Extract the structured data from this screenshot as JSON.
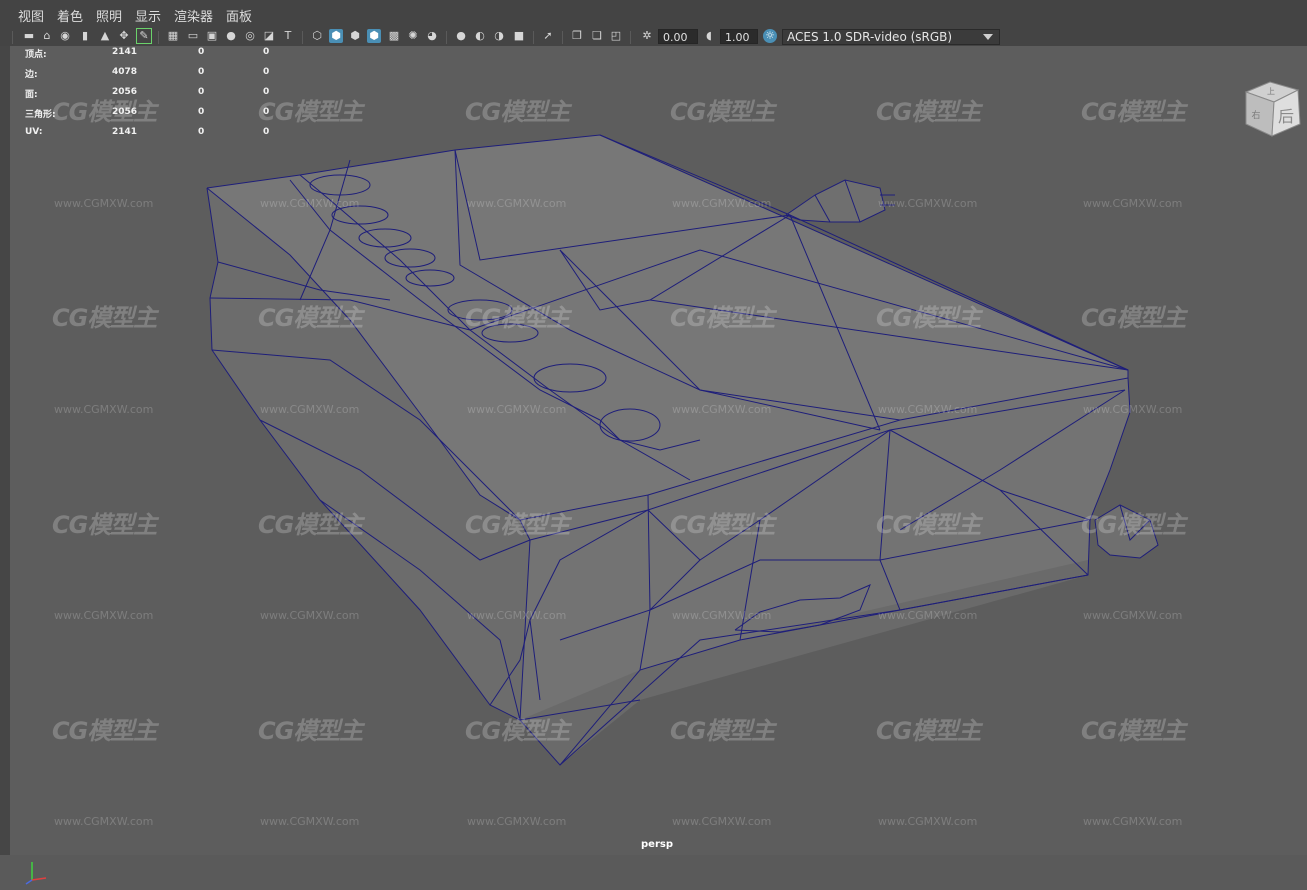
{
  "menu": {
    "items": [
      "视图",
      "着色",
      "照明",
      "显示",
      "渲染器",
      "面板"
    ]
  },
  "toolbar": {
    "exposure_value": "0.00",
    "gamma_value": "1.00",
    "color_space": "ACES 1.0 SDR-video (sRGB)",
    "icons": [
      "camera-icon",
      "lock-camera-icon",
      "camera-attributes-icon",
      "bookmark-icon",
      "image-plane-icon",
      "2d-pan-icon",
      "grease-pencil-icon",
      "grid-icon",
      "film-gate-icon",
      "resolution-gate-icon",
      "gate-mask-icon",
      "field-chart-icon",
      "safe-action-icon",
      "safe-title-icon",
      "wireframe-icon",
      "smooth-shade-icon",
      "wireframe-on-shaded-icon",
      "textured-icon",
      "use-all-lights-icon",
      "shadows-icon",
      "screen-space-ao-icon",
      "motion-blur-icon",
      "anti-aliasing-icon",
      "depth-of-field-icon",
      "isolate-select-icon",
      "xray-icon",
      "xray-joints-icon",
      "backface-culling-icon",
      "exposure-icon",
      "gamma-icon",
      "view-transform-icon"
    ]
  },
  "hud": {
    "rows": [
      {
        "label": "顶点:",
        "v1": "2141",
        "v2": "0",
        "v3": "0"
      },
      {
        "label": "边:",
        "v1": "4078",
        "v2": "0",
        "v3": "0"
      },
      {
        "label": "面:",
        "v1": "2056",
        "v2": "0",
        "v3": "0"
      },
      {
        "label": "三角形:",
        "v1": "2056",
        "v2": "0",
        "v3": "0"
      },
      {
        "label": "UV:",
        "v1": "2141",
        "v2": "0",
        "v3": "0"
      }
    ]
  },
  "viewcube": {
    "face_label": "后",
    "top_label": "上",
    "side_label": "右"
  },
  "camera_label": "persp",
  "watermark": {
    "logo_text": "CG模型主",
    "url_text": "www.CGMXW.com"
  },
  "colors": {
    "mesh_fill": "#767676",
    "wire": "#1e1e7a",
    "viewport_bg": "#5d5d5d",
    "active_icon": "#4a8fb5"
  }
}
